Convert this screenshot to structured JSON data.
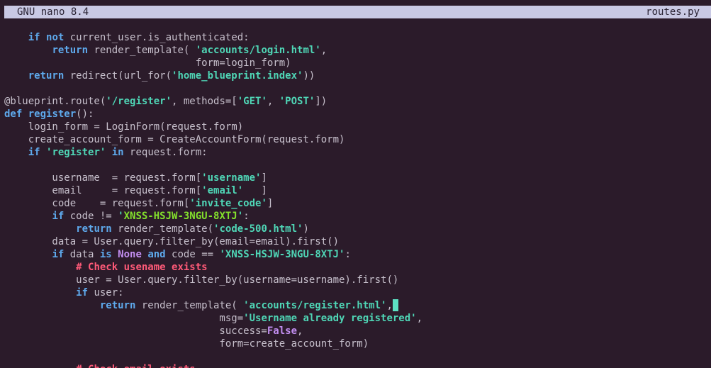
{
  "app": {
    "title": "GNU nano 8.4",
    "filename": "routes.py"
  },
  "colors": {
    "background": "#2b1b2a",
    "titlebar": "#c9c9e4",
    "keyword": "#5ea9ec",
    "string": "#4fd6b6",
    "code_value": "#83e02c",
    "comment": "#ff5a78",
    "constant": "#c28ef0",
    "cursor": "#5ce0c2"
  },
  "lines": [
    [
      [
        "    ",
        ""
      ],
      [
        "if",
        "kw"
      ],
      [
        " ",
        ""
      ],
      [
        "not",
        "kw"
      ],
      [
        " current_user.is_authenticated:",
        ""
      ]
    ],
    [
      [
        "        ",
        ""
      ],
      [
        "return",
        "kw"
      ],
      [
        " render_template( ",
        ""
      ],
      [
        "'accounts/login.html'",
        "str"
      ],
      [
        ",",
        ""
      ]
    ],
    [
      [
        "                                form=login_form)",
        ""
      ]
    ],
    [
      [
        "    ",
        ""
      ],
      [
        "return",
        "kw"
      ],
      [
        " redirect(url_for(",
        ""
      ],
      [
        "'home_blueprint.index'",
        "str"
      ],
      [
        "))",
        ""
      ]
    ],
    [],
    [
      [
        "@blueprint.route(",
        ""
      ],
      [
        "'/register'",
        "str"
      ],
      [
        ", methods=[",
        ""
      ],
      [
        "'GET'",
        "str"
      ],
      [
        ", ",
        ""
      ],
      [
        "'POST'",
        "str"
      ],
      [
        "])",
        ""
      ]
    ],
    [
      [
        "def",
        "kw"
      ],
      [
        " ",
        ""
      ],
      [
        "register",
        "kw"
      ],
      [
        "():",
        ""
      ]
    ],
    [
      [
        "    login_form = LoginForm(request.form)",
        ""
      ]
    ],
    [
      [
        "    create_account_form = CreateAccountForm(request.form)",
        ""
      ]
    ],
    [
      [
        "    ",
        ""
      ],
      [
        "if",
        "kw"
      ],
      [
        " ",
        ""
      ],
      [
        "'register'",
        "str"
      ],
      [
        " ",
        ""
      ],
      [
        "in",
        "kw"
      ],
      [
        " request.form:",
        ""
      ]
    ],
    [],
    [
      [
        "        username  = request.form[",
        ""
      ],
      [
        "'username'",
        "str"
      ],
      [
        "]",
        ""
      ]
    ],
    [
      [
        "        email     = request.form[",
        ""
      ],
      [
        "'email'",
        "str"
      ],
      [
        "   ]",
        ""
      ]
    ],
    [
      [
        "        code    = request.form[",
        ""
      ],
      [
        "'invite_code'",
        "str"
      ],
      [
        "]",
        ""
      ]
    ],
    [
      [
        "        ",
        ""
      ],
      [
        "if",
        "kw"
      ],
      [
        " code != ",
        ""
      ],
      [
        "'",
        "str"
      ],
      [
        "XNSS-HSJW-3NGU-8XTJ",
        "green"
      ],
      [
        "'",
        "str"
      ],
      [
        ":",
        ""
      ]
    ],
    [
      [
        "            ",
        ""
      ],
      [
        "return",
        "kw"
      ],
      [
        " render_template(",
        ""
      ],
      [
        "'code-500.html'",
        "str"
      ],
      [
        ")",
        ""
      ]
    ],
    [
      [
        "        data = User.query.filter_by(email=email).first()",
        ""
      ]
    ],
    [
      [
        "        ",
        ""
      ],
      [
        "if",
        "kw"
      ],
      [
        " data ",
        ""
      ],
      [
        "is",
        "kw"
      ],
      [
        " ",
        ""
      ],
      [
        "None",
        "kw2"
      ],
      [
        " ",
        ""
      ],
      [
        "and",
        "kw"
      ],
      [
        " code == ",
        ""
      ],
      [
        "'XNSS-HSJW-3NGU-8XTJ'",
        "str"
      ],
      [
        ":",
        ""
      ]
    ],
    [
      [
        "            ",
        ""
      ],
      [
        "# Check usename exists",
        "cmt"
      ]
    ],
    [
      [
        "            user = User.query.filter_by(username=username).first()",
        ""
      ]
    ],
    [
      [
        "            ",
        ""
      ],
      [
        "if",
        "kw"
      ],
      [
        " user:",
        ""
      ]
    ],
    [
      [
        "                ",
        ""
      ],
      [
        "return",
        "kw"
      ],
      [
        " render_template( ",
        ""
      ],
      [
        "'accounts/register.html'",
        "str"
      ],
      [
        ",",
        ""
      ],
      [
        "",
        "cursor"
      ]
    ],
    [
      [
        "                                    msg=",
        ""
      ],
      [
        "'Username already registered'",
        "str"
      ],
      [
        ",",
        ""
      ]
    ],
    [
      [
        "                                    success=",
        ""
      ],
      [
        "False",
        "kw2"
      ],
      [
        ",",
        ""
      ]
    ],
    [
      [
        "                                    form=create_account_form)",
        ""
      ]
    ],
    [],
    [
      [
        "            ",
        ""
      ],
      [
        "# Check email exists",
        "cmt"
      ]
    ]
  ]
}
